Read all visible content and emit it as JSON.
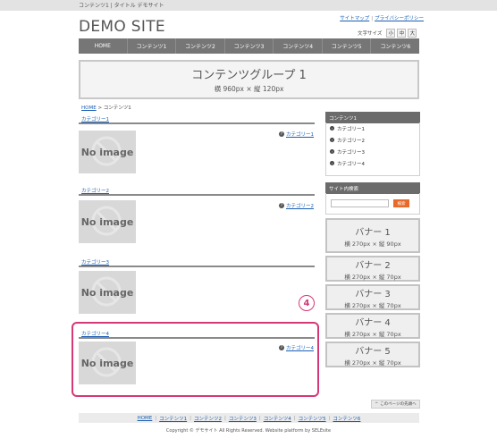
{
  "topbar": {
    "text": "コンテンツ1 | タイトル デモサイト"
  },
  "logo": "DEMO SITE",
  "header_links": [
    "サイトマップ",
    "プライバシーポリシー"
  ],
  "font_size": {
    "label": "文字サイズ",
    "buttons": [
      "小",
      "中",
      "大"
    ]
  },
  "nav": [
    "HOME",
    "コンテンツ1",
    "コンテンツ2",
    "コンテンツ3",
    "コンテンツ4",
    "コンテンツ5",
    "コンテンツ6"
  ],
  "group_banner": {
    "title": "コンテンツグループ 1",
    "subtitle": "横 960px × 縦 120px"
  },
  "breadcrumb": {
    "home": "HOME",
    "sep": ">",
    "current": "コンテンツ1"
  },
  "sections": [
    {
      "title": "カテゴリー1",
      "link": "カテゴリー1",
      "image_text": "No image"
    },
    {
      "title": "カテゴリー2",
      "link": "カテゴリー2",
      "image_text": "No image"
    },
    {
      "title": "カテゴリー3",
      "link": "カテゴリー3",
      "image_text": "No image"
    },
    {
      "title": "カテゴリー4",
      "link": "カテゴリー4",
      "image_text": "No image"
    }
  ],
  "step_number": "4",
  "sidebar": {
    "heading": "コンテンツ1",
    "items": [
      "カテゴリー1",
      "カテゴリー2",
      "カテゴリー3",
      "カテゴリー4"
    ],
    "search_heading": "サイト内検索",
    "search_placeholder": "",
    "search_button": "検索"
  },
  "banners": [
    {
      "title": "バナー 1",
      "subtitle": "横 270px × 縦 90px"
    },
    {
      "title": "バナー 2",
      "subtitle": "横 270px × 縦 70px"
    },
    {
      "title": "バナー 3",
      "subtitle": "横 270px × 縦 70px"
    },
    {
      "title": "バナー 4",
      "subtitle": "横 270px × 縦 70px"
    },
    {
      "title": "バナー 5",
      "subtitle": "横 270px × 縦 70px"
    }
  ],
  "page_top": "このページの先頭へ",
  "footer_nav": [
    "HOME",
    "コンテンツ1",
    "コンテンツ2",
    "コンテンツ3",
    "コンテンツ4",
    "コンテンツ5",
    "コンテンツ6"
  ],
  "copyright": "Copyright © デモサイト All Rights Reserved. Website platform by SELEsite"
}
